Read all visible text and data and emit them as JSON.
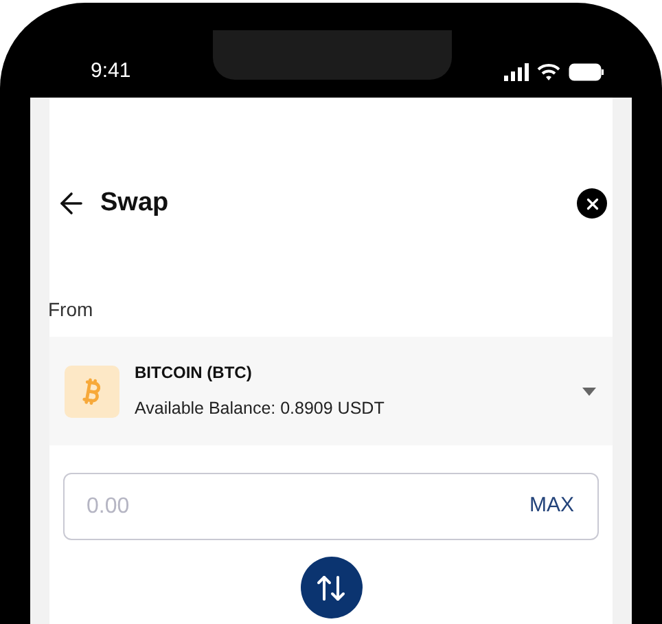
{
  "status_bar": {
    "time": "9:41"
  },
  "header": {
    "title": "Swap"
  },
  "from": {
    "label": "From",
    "coin_name": "BITCOIN (BTC)",
    "balance": "Available Balance: 0.8909 USDT"
  },
  "amount": {
    "placeholder": "0.00",
    "max_label": "MAX"
  }
}
